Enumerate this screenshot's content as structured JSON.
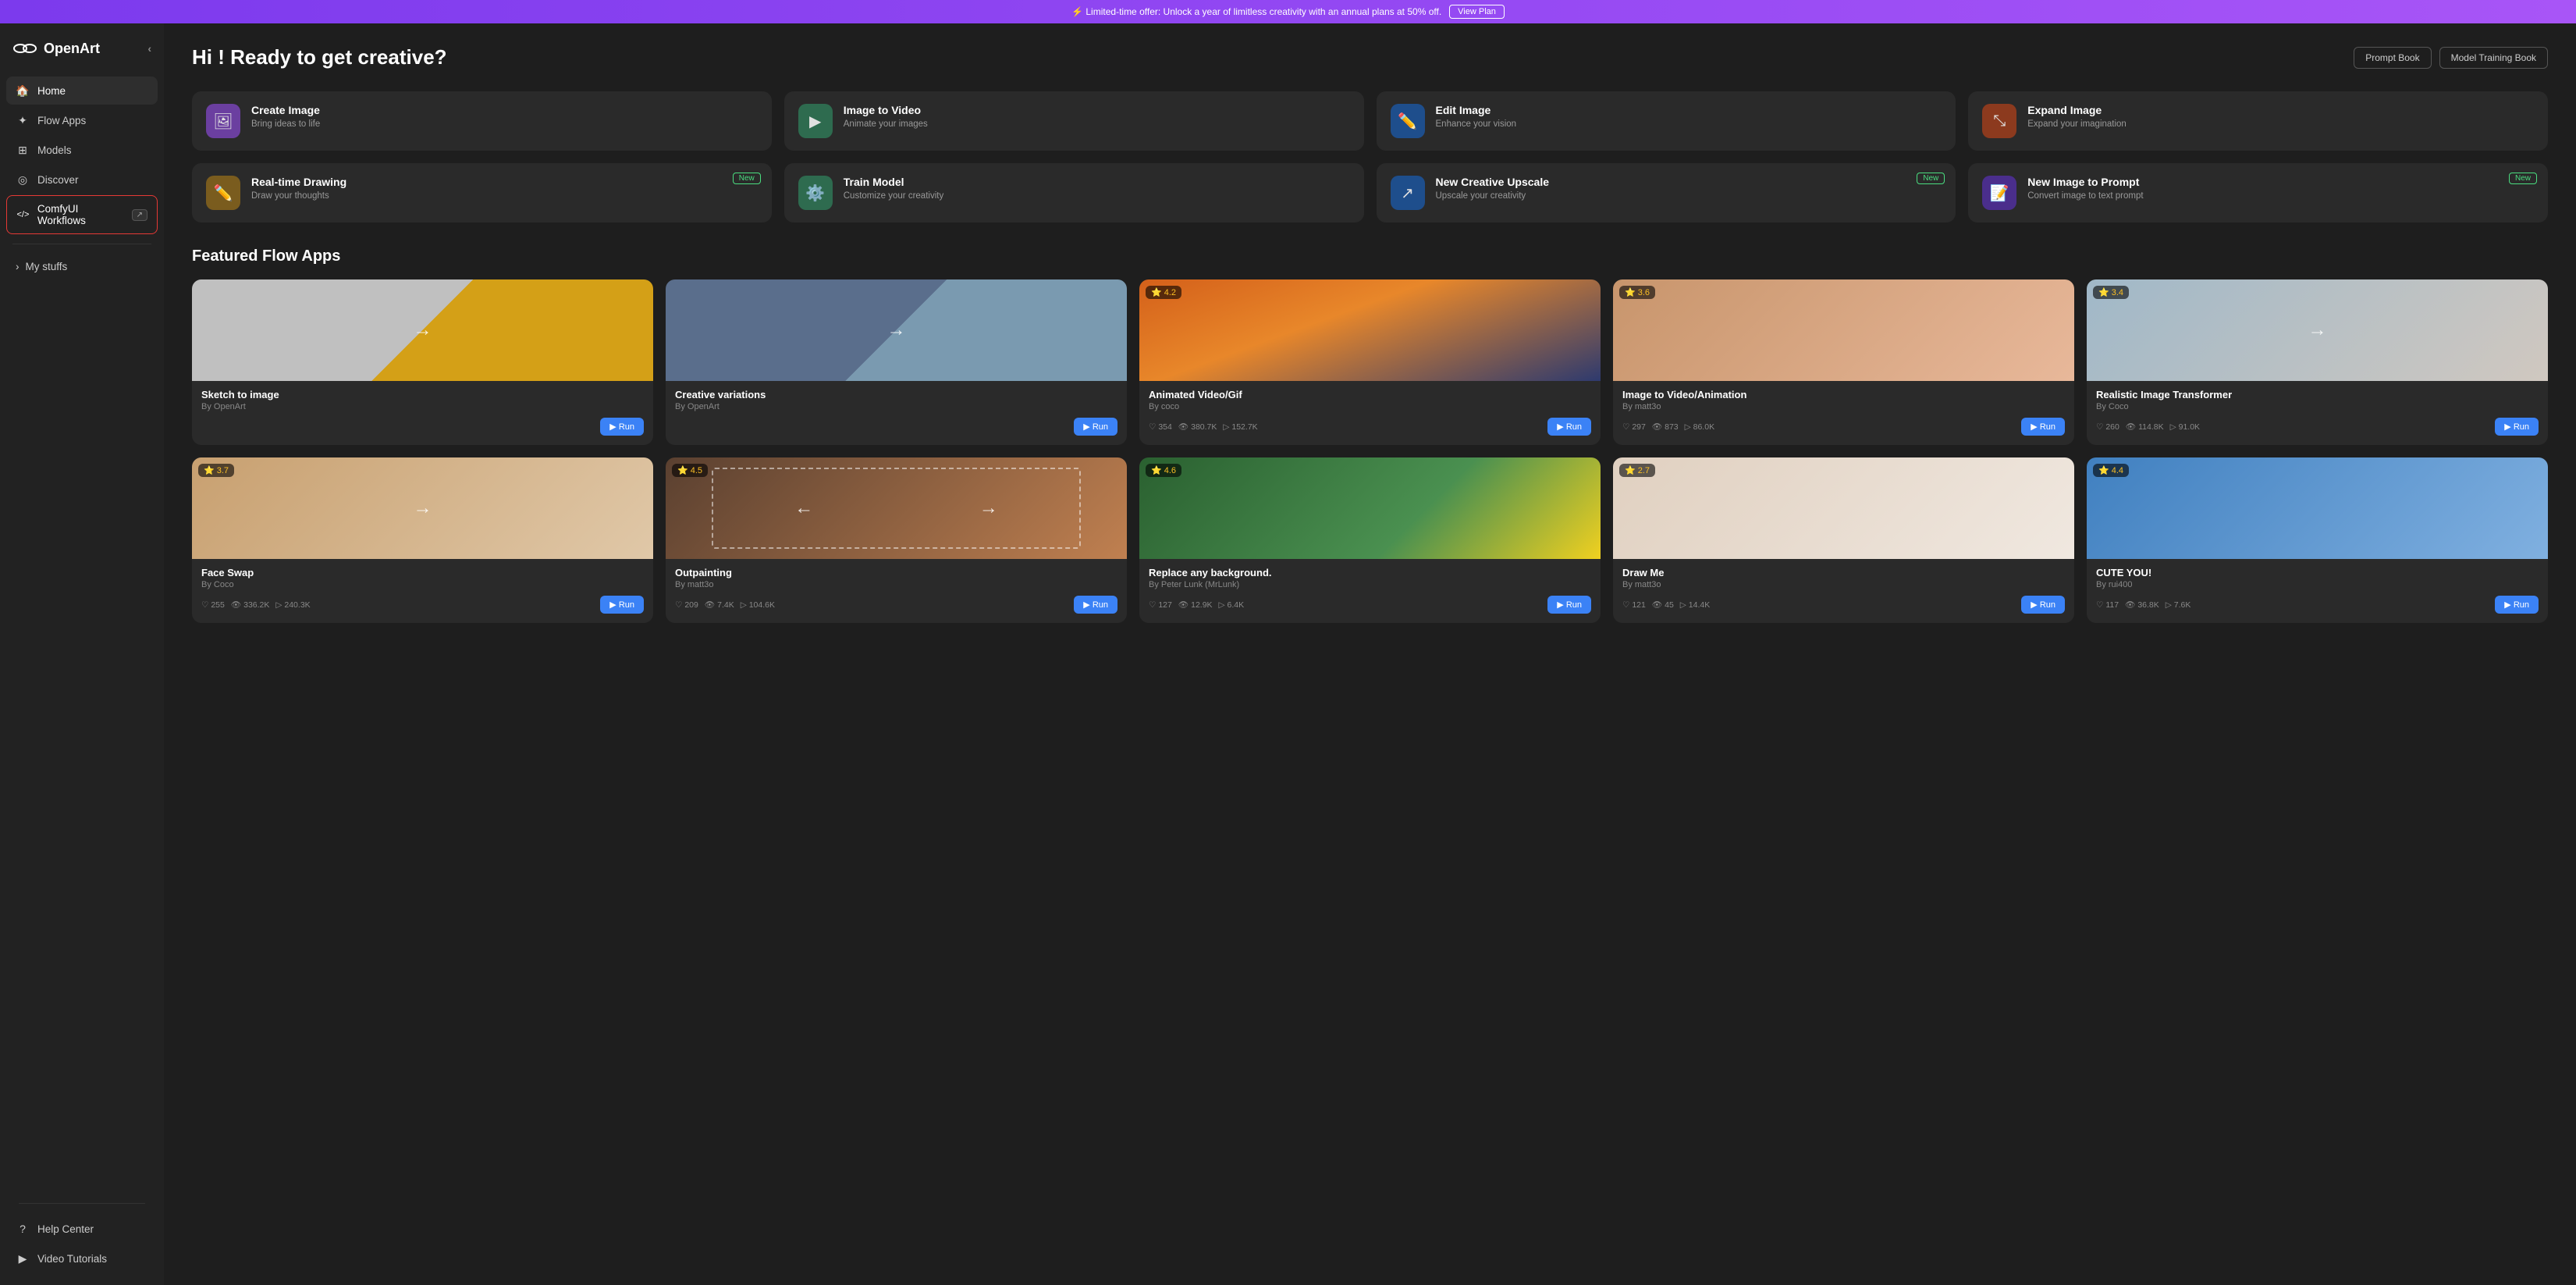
{
  "banner": {
    "text": "⚡ Limited-time offer: Unlock a year of limitless creativity with an annual plans at 50% off.",
    "link_label": "View Plan"
  },
  "sidebar": {
    "logo": "OpenArt",
    "collapse_label": "‹",
    "nav_items": [
      {
        "id": "home",
        "label": "Home",
        "icon": "🏠",
        "active": true
      },
      {
        "id": "flow-apps",
        "label": "Flow Apps",
        "icon": "✦"
      },
      {
        "id": "models",
        "label": "Models",
        "icon": "⊞"
      },
      {
        "id": "discover",
        "label": "Discover",
        "icon": "◎"
      },
      {
        "id": "comfy-workflows",
        "label": "ComfyUI Workflows",
        "icon": "</>",
        "badge": "↗",
        "special": true
      }
    ],
    "my_stuffs_label": "My stuffs",
    "bottom_items": [
      {
        "id": "help-center",
        "label": "Help Center",
        "icon": "?"
      },
      {
        "id": "video-tutorials",
        "label": "Video Tutorials",
        "icon": "▶"
      }
    ]
  },
  "main": {
    "greeting": "Hi ! Ready to get creative?",
    "header_buttons": [
      {
        "id": "prompt-book",
        "label": "Prompt Book"
      },
      {
        "id": "model-training-book",
        "label": "Model Training Book"
      }
    ],
    "features": [
      {
        "id": "create-image",
        "title": "Create Image",
        "description": "Bring ideas to life",
        "icon": "🖼",
        "icon_bg": "#6b3fa0",
        "new": false
      },
      {
        "id": "image-to-video",
        "title": "Image to Video",
        "description": "Animate your images",
        "icon": "▶",
        "icon_bg": "#2e6b4f",
        "new": false
      },
      {
        "id": "edit-image",
        "title": "Edit Image",
        "description": "Enhance your vision",
        "icon": "✏",
        "icon_bg": "#1e4e8c",
        "new": false
      },
      {
        "id": "expand-image",
        "title": "Expand Image",
        "description": "Expand your imagination",
        "icon": "⊞",
        "icon_bg": "#8c3a1e",
        "new": false
      },
      {
        "id": "real-time-drawing",
        "title": "Real-time Drawing",
        "description": "Draw your thoughts",
        "icon": "✏",
        "icon_bg": "#7a5c1e",
        "new": true
      },
      {
        "id": "train-model",
        "title": "Train Model",
        "description": "Customize your creativity",
        "icon": "⚙",
        "icon_bg": "#2e6b4f",
        "new": false
      },
      {
        "id": "creative-upscale",
        "title": "New Creative Upscale",
        "description": "Upscale your creativity",
        "icon": "↗",
        "icon_bg": "#1e4e8c",
        "new": true
      },
      {
        "id": "image-to-prompt",
        "title": "New Image to Prompt",
        "description": "Convert image to text prompt",
        "icon": "📝",
        "icon_bg": "#4a2e8c",
        "new": true
      }
    ],
    "featured_section_title": "Featured Flow Apps",
    "flow_apps_row1": [
      {
        "id": "sketch-to-image",
        "title": "Sketch to image",
        "author": "By OpenArt",
        "stars": null,
        "hearts": null,
        "views": null,
        "runs": null,
        "img_class": "img-sketch",
        "arrow": "→"
      },
      {
        "id": "creative-variations",
        "title": "Creative variations",
        "author": "By OpenArt",
        "stars": null,
        "hearts": null,
        "views": null,
        "runs": null,
        "img_class": "img-creative",
        "arrow": "→"
      },
      {
        "id": "animated-video-gif",
        "title": "Animated Video/Gif",
        "author": "By coco",
        "stars": "4.2",
        "hearts": "354",
        "views": "380.7K",
        "runs": "152.7K",
        "img_class": "img-animated",
        "arrow": null
      },
      {
        "id": "image-to-video-animation",
        "title": "Image to Video/Animation",
        "author": "By matt3o",
        "stars": "3.6",
        "hearts": "297",
        "views": "873",
        "runs": "86.0K",
        "img_class": "img-vid-anim",
        "arrow": null
      },
      {
        "id": "realistic-image-transformer",
        "title": "Realistic Image Transformer",
        "author": "By Coco",
        "stars": "3.4",
        "hearts": "260",
        "views": "114.8K",
        "runs": "91.0K",
        "img_class": "img-realistic",
        "arrow": "→"
      }
    ],
    "flow_apps_row2": [
      {
        "id": "face-swap",
        "title": "Face Swap",
        "author": "By Coco",
        "stars": "3.7",
        "hearts": "255",
        "views": "336.2K",
        "runs": "240.3K",
        "img_class": "img-faceswap",
        "arrow": "→"
      },
      {
        "id": "outpainting",
        "title": "Outpainting",
        "author": "By matt3o",
        "stars": "4.5",
        "hearts": "209",
        "views": "7.4K",
        "runs": "104.6K",
        "img_class": "img-outpainting",
        "arrow_left": "←",
        "arrow_right": "→"
      },
      {
        "id": "replace-background",
        "title": "Replace any background.",
        "author": "By Peter Lunk (MrLunk)",
        "stars": "4.6",
        "hearts": "127",
        "views": "12.9K",
        "runs": "6.4K",
        "img_class": "img-replace",
        "arrow": null
      },
      {
        "id": "draw-me",
        "title": "Draw Me",
        "author": "By matt3o",
        "stars": "2.7",
        "hearts": "121",
        "views": "45",
        "runs": "14.4K",
        "img_class": "img-drawme",
        "arrow": null
      },
      {
        "id": "cute-you",
        "title": "CUTE YOU!",
        "author": "By rui400",
        "stars": "4.4",
        "hearts": "117",
        "views": "36.8K",
        "runs": "7.6K",
        "img_class": "img-cute",
        "arrow": null
      }
    ],
    "run_label": "▶ Run"
  }
}
